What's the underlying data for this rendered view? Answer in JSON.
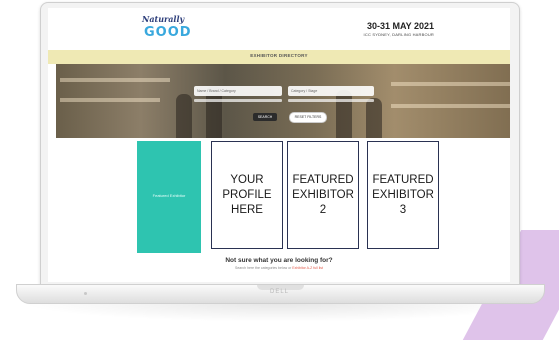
{
  "logo": {
    "script": "Naturally",
    "word": "GOOD"
  },
  "event": {
    "date": "30-31 MAY 2021",
    "venue": "ICC SYDNEY, DARLING HARBOUR"
  },
  "directory_bar": {
    "label": "EXHIBITOR DIRECTORY"
  },
  "search": {
    "keyword_placeholder": "Name / Brand / Category",
    "category_placeholder": "Category / Stage",
    "search_label": "SEARCH",
    "reset_label": "RESET FILTERS"
  },
  "cards": {
    "featured_label": "Featured Exhibitor",
    "profile": "YOUR\nPROFILE\nHERE",
    "exhibitor_2": "FEATURED\nEXHIBITOR\n2",
    "exhibitor_3": "FEATURED\nEXHIBITOR\n3"
  },
  "footer": {
    "question": "Not sure what you are looking for?",
    "sub_prefix": "Search here the categories below or ",
    "sub_link": "Exhibitor A-Z full list"
  },
  "laptop": {
    "brand": "DELL"
  },
  "colors": {
    "teal": "#2ec4b0",
    "banner": "#efe9b4",
    "card_border": "#2a3252",
    "accent_purple": "#d9b9e6"
  }
}
